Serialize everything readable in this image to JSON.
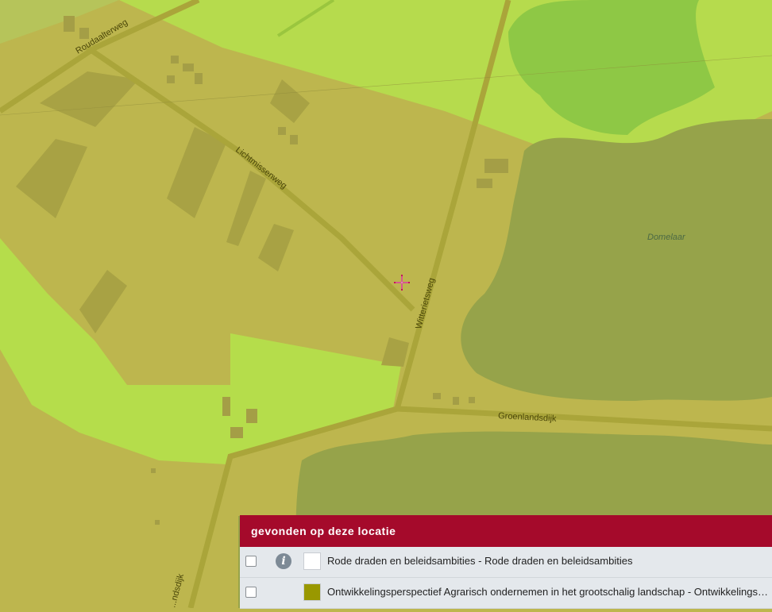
{
  "map": {
    "road_labels": [
      "Roudaalterweg",
      "Lichtmissenweg",
      "Witterietsweg",
      "Groenlandsdijk",
      "...ndsdijk"
    ],
    "water_label": "Domelaar",
    "colors": {
      "base_olive": "#bdb64e",
      "bright_green_overlay": "#b5dc4c",
      "lime_overlay": "#b8e14a",
      "water_dark": "#96a34a",
      "water_green": "#8fc845",
      "road": "#aaa53a"
    },
    "marker": "crosshair-icon"
  },
  "panel": {
    "title": "gevonden op deze locatie",
    "rows": [
      {
        "label": "Rode draden en beleidsambities - Rode draden en beleidsambities",
        "swatch_color": "#ffffff",
        "has_info": true,
        "info_glyph": "i"
      },
      {
        "label": "Ontwikkelingsperspectief Agrarisch ondernemen in het grootschalig landschap - Ontwikkelingsperspectief Agrarisch ondernemen in het grootschalig landschap",
        "swatch_color": "#999800",
        "has_info": false
      }
    ]
  }
}
